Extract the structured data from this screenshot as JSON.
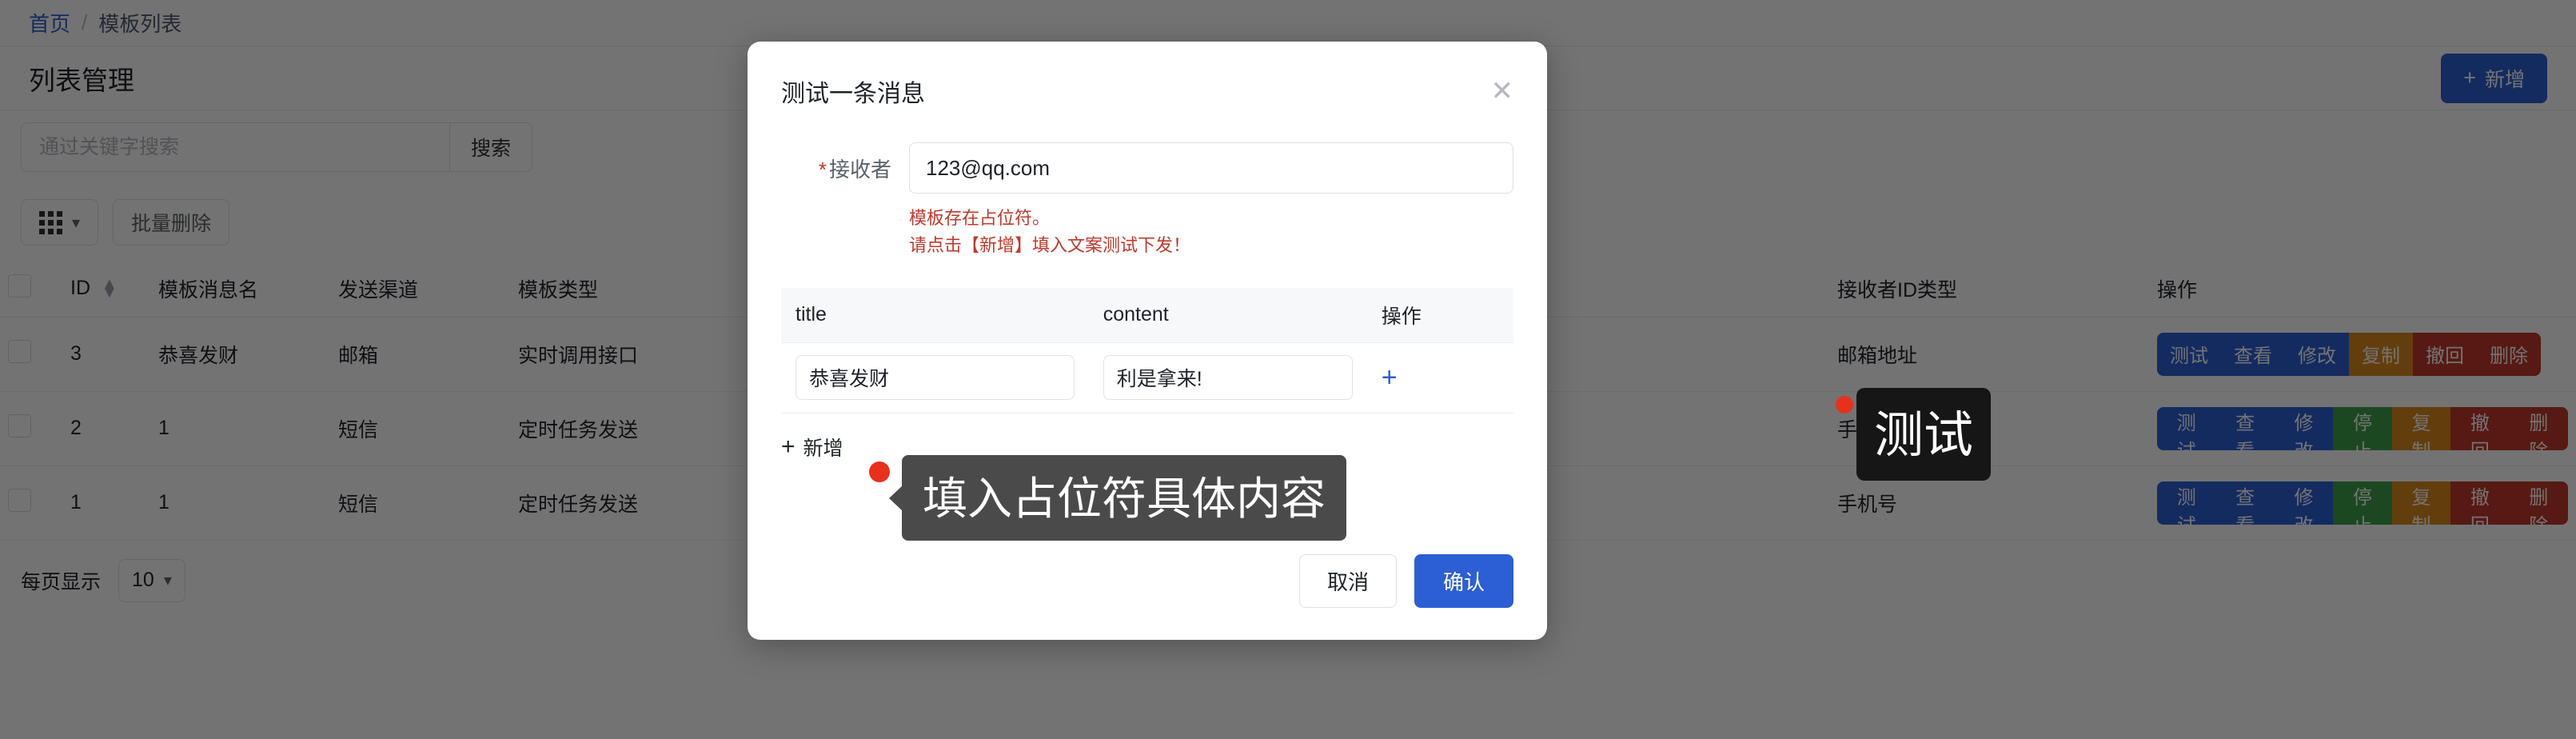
{
  "breadcrumb": {
    "home": "首页",
    "separator": "/",
    "current": "模板列表"
  },
  "page": {
    "title": "列表管理",
    "add_label": "新增",
    "add_icon": "plus-icon"
  },
  "search": {
    "placeholder": "通过关键字搜索",
    "value": "",
    "button_label": "搜索"
  },
  "toolbar": {
    "columns_icon": "grid-icon",
    "columns_chevron": "chevron-down-icon",
    "batch_delete_label": "批量删除"
  },
  "table": {
    "columns": [
      "ID",
      "模板消息名",
      "发送渠道",
      "模板类型",
      "接收者ID类型",
      "操作"
    ],
    "sort_icon": "sort-updown-icon",
    "rows": [
      {
        "id": "3",
        "name": "恭喜发财",
        "channel": "邮箱",
        "type": "实时调用接口",
        "receiver_type": "邮箱地址"
      },
      {
        "id": "2",
        "name": "1",
        "channel": "短信",
        "type": "定时任务发送",
        "receiver_type": "手机号"
      },
      {
        "id": "1",
        "name": "1",
        "channel": "短信",
        "type": "定时任务发送",
        "receiver_type": "手机号"
      }
    ],
    "row_actions": [
      {
        "label": "测试",
        "color": "#2d5fd4"
      },
      {
        "label": "查看",
        "color": "#2d5fd4"
      },
      {
        "label": "修改",
        "color": "#2d5fd4"
      },
      {
        "label": "停止",
        "color": "#3f9f4a"
      },
      {
        "label": "复制",
        "color": "#d98a1c"
      },
      {
        "label": "撤回",
        "color": "#c0392b"
      },
      {
        "label": "删除",
        "color": "#c0392b"
      }
    ]
  },
  "pager": {
    "label": "每页显示",
    "page_size": "10",
    "chevron": "chevron-down-icon"
  },
  "modal": {
    "title": "测试一条消息",
    "close_icon": "close-icon",
    "receiver": {
      "label": "接收者",
      "required_mark": "*",
      "value": "123@qq.com"
    },
    "warning_line1": "模板存在占位符。",
    "warning_line2": "请点击【新增】填入文案测试下发！",
    "inner_table": {
      "columns": [
        "title",
        "content",
        "操作"
      ],
      "rows": [
        {
          "title": "恭喜发财",
          "content": "利是拿来!",
          "add_icon": "plus-icon"
        }
      ]
    },
    "add_row_label": "新增",
    "add_row_icon": "plus-icon",
    "cancel_label": "取消",
    "confirm_label": "确认"
  },
  "annotations": {
    "tooltip_add_row": "填入占位符具体内容",
    "tooltip_test_button": "测试",
    "marker_color": "#e8301c"
  },
  "colors": {
    "accent": "#2d5fd4",
    "danger": "#c0392b",
    "success": "#3f9f4a",
    "warning": "#d98a1c",
    "overlay": "rgba(0,0,0,0.55)"
  }
}
